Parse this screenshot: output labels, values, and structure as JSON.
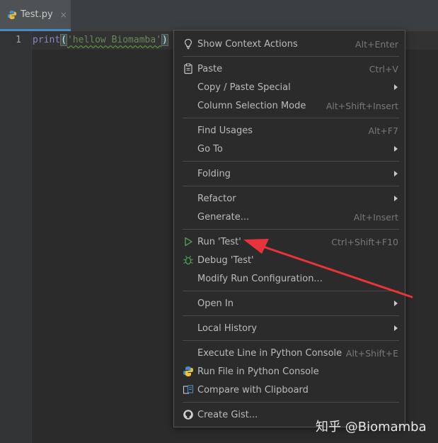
{
  "tab": {
    "filename": "Test.py",
    "close_symbol": "×"
  },
  "editor": {
    "line_number": "1",
    "code": {
      "fn": "print",
      "open": "(",
      "string": "'hellow Biomamba'",
      "close": ")"
    }
  },
  "menu": {
    "show_context_actions": {
      "label": "Show Context Actions",
      "shortcut": "Alt+Enter"
    },
    "paste": {
      "label": "Paste",
      "shortcut": "Ctrl+V"
    },
    "copy_paste_special": {
      "label": "Copy / Paste Special"
    },
    "column_selection_mode": {
      "label": "Column Selection Mode",
      "shortcut": "Alt+Shift+Insert"
    },
    "find_usages": {
      "label": "Find Usages",
      "shortcut": "Alt+F7"
    },
    "go_to": {
      "label": "Go To"
    },
    "folding": {
      "label": "Folding"
    },
    "refactor": {
      "label": "Refactor"
    },
    "generate": {
      "label": "Generate...",
      "shortcut": "Alt+Insert"
    },
    "run_test": {
      "label": "Run 'Test'",
      "shortcut": "Ctrl+Shift+F10"
    },
    "debug_test": {
      "label": "Debug 'Test'"
    },
    "modify_run_config": {
      "label": "Modify Run Configuration..."
    },
    "open_in": {
      "label": "Open In"
    },
    "local_history": {
      "label": "Local History"
    },
    "execute_line": {
      "label": "Execute Line in Python Console",
      "shortcut": "Alt+Shift+E"
    },
    "run_file_console": {
      "label": "Run File in Python Console"
    },
    "compare_clipboard": {
      "label": "Compare with Clipboard"
    },
    "create_gist": {
      "label": "Create Gist..."
    }
  },
  "watermark": "知乎 @Biomamba",
  "colors": {
    "run_green": "#499c54",
    "annotation_red": "#e8333a",
    "tab_underline": "#4a88c7"
  },
  "icons": [
    "python-file-icon",
    "lightbulb-icon",
    "clipboard-icon",
    "run-triangle-icon",
    "bug-icon",
    "python-console-icon",
    "compare-icon",
    "github-icon"
  ]
}
